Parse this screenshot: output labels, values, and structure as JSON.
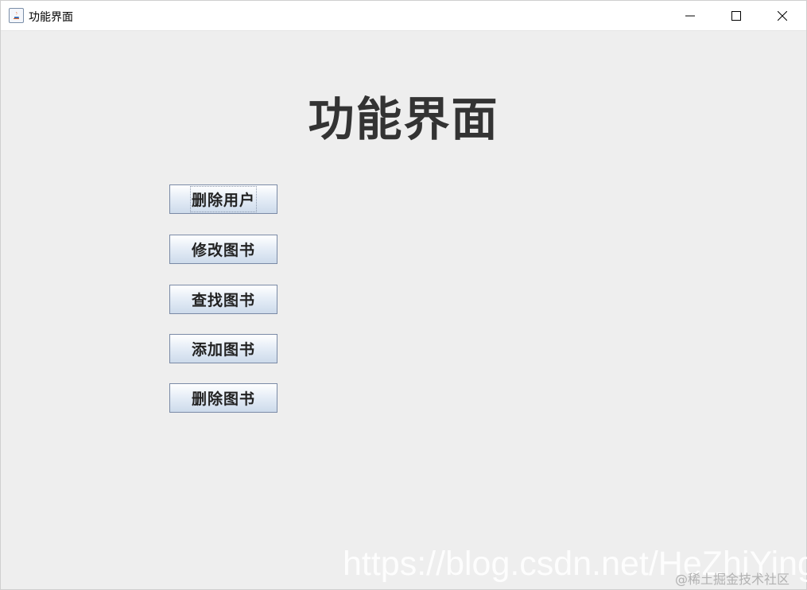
{
  "window": {
    "title": "功能界面"
  },
  "heading": "功能界面",
  "buttons": [
    {
      "label": "删除用户",
      "focused": true
    },
    {
      "label": "修改图书",
      "focused": false
    },
    {
      "label": "查找图书",
      "focused": false
    },
    {
      "label": "添加图书",
      "focused": false
    },
    {
      "label": "删除图书",
      "focused": false
    }
  ],
  "watermark": {
    "url": "https://blog.csdn.net/HeZhiYing",
    "site": "@稀土掘金技术社区"
  },
  "icons": {
    "app": "java-icon",
    "minimize": "minimize-icon",
    "maximize": "maximize-icon",
    "close": "close-icon"
  }
}
